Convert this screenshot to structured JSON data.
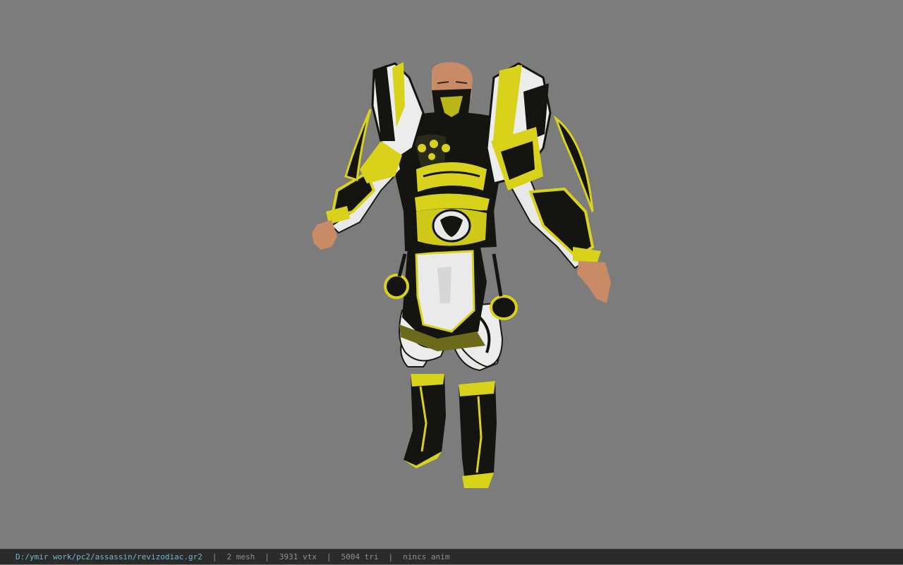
{
  "viewport": {
    "background": "#7c7c7c",
    "model": {
      "icon": "armored-character-model",
      "accent_gold": "#d8d21a",
      "armor_white": "#e8e8e8",
      "armor_black": "#151510",
      "skin": "#c98a66"
    }
  },
  "statusbar": {
    "path": "D:/ymir work/pc2/assassin/revizodiac.gr2",
    "separator": "|",
    "mesh": "2 mesh",
    "vtx": "3931 vtx",
    "tri": "5004 tri",
    "anim": "nincs anim",
    "path_color": "#6fb9c9"
  }
}
